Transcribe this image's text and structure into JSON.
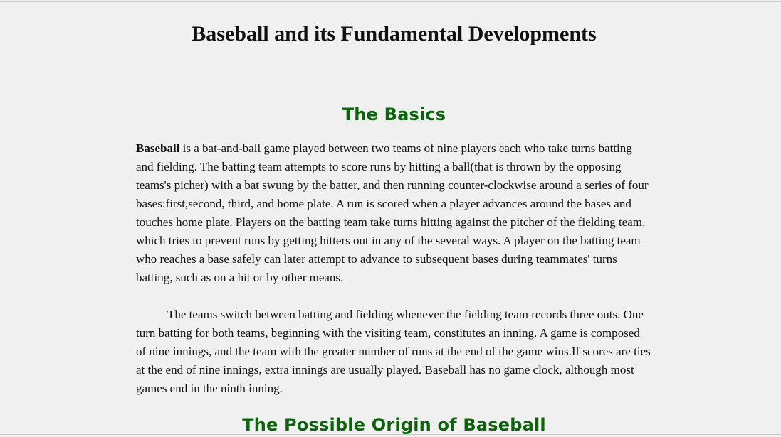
{
  "page": {
    "title": "Baseball and its Fundamental Developments"
  },
  "sections": [
    {
      "heading": "The Basics",
      "paragraphs": [
        {
          "lead_bold": "Baseball",
          "text": " is a bat-and-ball game played between two teams of nine players each who take turns batting and fielding. The batting team attempts to score runs by hitting a ball(that is thrown by the opposing teams's picher) with a bat swung by the batter, and then running counter-clockwise around a series of four bases:first,second, third, and home plate. A run is scored when a player advances around the bases and touches home plate. Players on the batting team take turns hitting against the pitcher of the fielding team, which tries to prevent runs by getting hitters out in any of the several ways. A player on the batting team who reaches a base safely can later attempt to advance to subsequent bases during teammates' turns batting, such as on a hit or by other means."
        },
        {
          "text": "The teams switch between batting and fielding whenever the fielding team records three outs. One turn batting for both teams, beginning with the visiting team, constitutes an inning. A game is composed of nine innings, and the team with the greater number of runs at the end of the game wins.If scores are ties at the end of nine innings, extra innings are usually played. Baseball has no game clock, although most games end in the ninth inning."
        }
      ]
    },
    {
      "heading": "The Possible Origin of Baseball"
    }
  ],
  "colors": {
    "background": "#f0f0f0",
    "heading_green": "#0b640b",
    "text": "#111111"
  }
}
